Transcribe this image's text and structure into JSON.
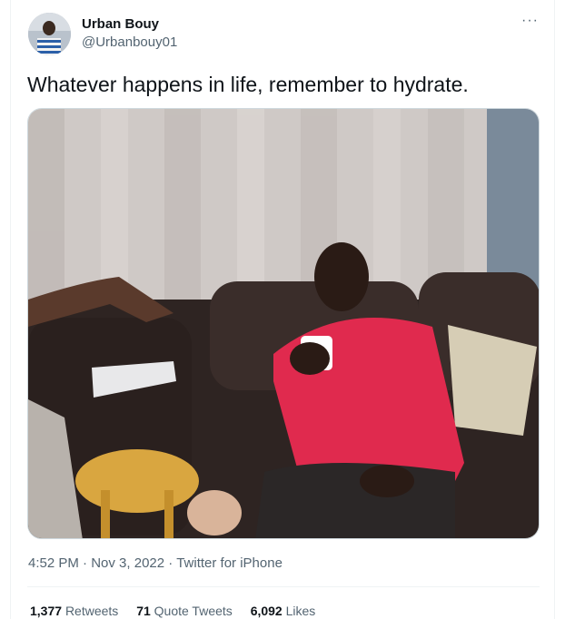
{
  "tweet": {
    "author_name": "Urban Bouy",
    "author_handle": "@Urbanbouy01",
    "more_glyph": "···",
    "text": "Whatever happens in life, remember to hydrate.",
    "time": "4:52 PM",
    "date": "Nov 3, 2022",
    "sep": "·",
    "source": "Twitter for iPhone"
  },
  "stats": {
    "retweets_count": "1,377",
    "retweets_label": "Retweets",
    "quotes_count": "71",
    "quotes_label": "Quote Tweets",
    "likes_count": "6,092",
    "likes_label": "Likes"
  },
  "colors": {
    "text_primary": "#0f1419",
    "text_secondary": "#536471",
    "border": "#eff3f4"
  }
}
